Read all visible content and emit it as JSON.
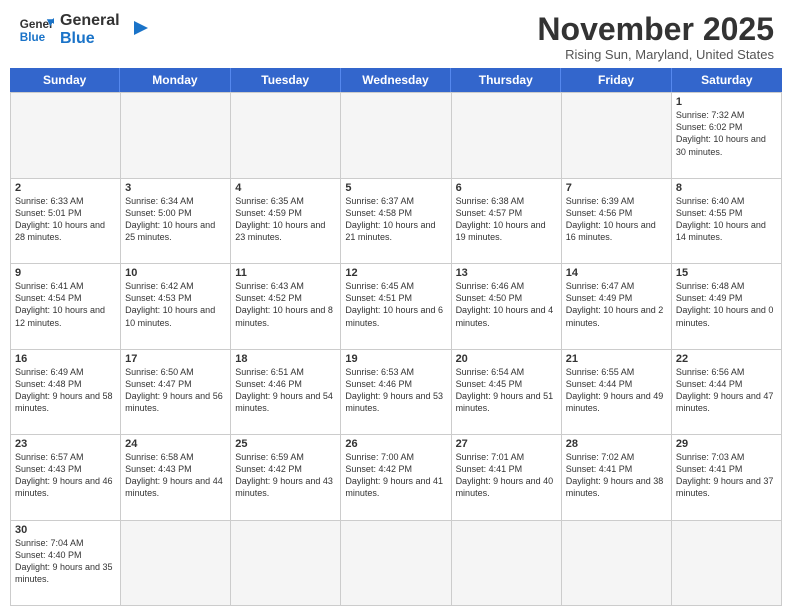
{
  "header": {
    "logo_general": "General",
    "logo_blue": "Blue",
    "month_title": "November 2025",
    "subtitle": "Rising Sun, Maryland, United States"
  },
  "days_of_week": [
    "Sunday",
    "Monday",
    "Tuesday",
    "Wednesday",
    "Thursday",
    "Friday",
    "Saturday"
  ],
  "weeks": [
    [
      {
        "day": "",
        "empty": true,
        "info": ""
      },
      {
        "day": "",
        "empty": true,
        "info": ""
      },
      {
        "day": "",
        "empty": true,
        "info": ""
      },
      {
        "day": "",
        "empty": true,
        "info": ""
      },
      {
        "day": "",
        "empty": true,
        "info": ""
      },
      {
        "day": "",
        "empty": true,
        "info": ""
      },
      {
        "day": "1",
        "empty": false,
        "info": "Sunrise: 7:32 AM\nSunset: 6:02 PM\nDaylight: 10 hours and 30 minutes."
      }
    ],
    [
      {
        "day": "2",
        "empty": false,
        "info": "Sunrise: 6:33 AM\nSunset: 5:01 PM\nDaylight: 10 hours and 28 minutes."
      },
      {
        "day": "3",
        "empty": false,
        "info": "Sunrise: 6:34 AM\nSunset: 5:00 PM\nDaylight: 10 hours and 25 minutes."
      },
      {
        "day": "4",
        "empty": false,
        "info": "Sunrise: 6:35 AM\nSunset: 4:59 PM\nDaylight: 10 hours and 23 minutes."
      },
      {
        "day": "5",
        "empty": false,
        "info": "Sunrise: 6:37 AM\nSunset: 4:58 PM\nDaylight: 10 hours and 21 minutes."
      },
      {
        "day": "6",
        "empty": false,
        "info": "Sunrise: 6:38 AM\nSunset: 4:57 PM\nDaylight: 10 hours and 19 minutes."
      },
      {
        "day": "7",
        "empty": false,
        "info": "Sunrise: 6:39 AM\nSunset: 4:56 PM\nDaylight: 10 hours and 16 minutes."
      },
      {
        "day": "8",
        "empty": false,
        "info": "Sunrise: 6:40 AM\nSunset: 4:55 PM\nDaylight: 10 hours and 14 minutes."
      }
    ],
    [
      {
        "day": "9",
        "empty": false,
        "info": "Sunrise: 6:41 AM\nSunset: 4:54 PM\nDaylight: 10 hours and 12 minutes."
      },
      {
        "day": "10",
        "empty": false,
        "info": "Sunrise: 6:42 AM\nSunset: 4:53 PM\nDaylight: 10 hours and 10 minutes."
      },
      {
        "day": "11",
        "empty": false,
        "info": "Sunrise: 6:43 AM\nSunset: 4:52 PM\nDaylight: 10 hours and 8 minutes."
      },
      {
        "day": "12",
        "empty": false,
        "info": "Sunrise: 6:45 AM\nSunset: 4:51 PM\nDaylight: 10 hours and 6 minutes."
      },
      {
        "day": "13",
        "empty": false,
        "info": "Sunrise: 6:46 AM\nSunset: 4:50 PM\nDaylight: 10 hours and 4 minutes."
      },
      {
        "day": "14",
        "empty": false,
        "info": "Sunrise: 6:47 AM\nSunset: 4:49 PM\nDaylight: 10 hours and 2 minutes."
      },
      {
        "day": "15",
        "empty": false,
        "info": "Sunrise: 6:48 AM\nSunset: 4:49 PM\nDaylight: 10 hours and 0 minutes."
      }
    ],
    [
      {
        "day": "16",
        "empty": false,
        "info": "Sunrise: 6:49 AM\nSunset: 4:48 PM\nDaylight: 9 hours and 58 minutes."
      },
      {
        "day": "17",
        "empty": false,
        "info": "Sunrise: 6:50 AM\nSunset: 4:47 PM\nDaylight: 9 hours and 56 minutes."
      },
      {
        "day": "18",
        "empty": false,
        "info": "Sunrise: 6:51 AM\nSunset: 4:46 PM\nDaylight: 9 hours and 54 minutes."
      },
      {
        "day": "19",
        "empty": false,
        "info": "Sunrise: 6:53 AM\nSunset: 4:46 PM\nDaylight: 9 hours and 53 minutes."
      },
      {
        "day": "20",
        "empty": false,
        "info": "Sunrise: 6:54 AM\nSunset: 4:45 PM\nDaylight: 9 hours and 51 minutes."
      },
      {
        "day": "21",
        "empty": false,
        "info": "Sunrise: 6:55 AM\nSunset: 4:44 PM\nDaylight: 9 hours and 49 minutes."
      },
      {
        "day": "22",
        "empty": false,
        "info": "Sunrise: 6:56 AM\nSunset: 4:44 PM\nDaylight: 9 hours and 47 minutes."
      }
    ],
    [
      {
        "day": "23",
        "empty": false,
        "info": "Sunrise: 6:57 AM\nSunset: 4:43 PM\nDaylight: 9 hours and 46 minutes."
      },
      {
        "day": "24",
        "empty": false,
        "info": "Sunrise: 6:58 AM\nSunset: 4:43 PM\nDaylight: 9 hours and 44 minutes."
      },
      {
        "day": "25",
        "empty": false,
        "info": "Sunrise: 6:59 AM\nSunset: 4:42 PM\nDaylight: 9 hours and 43 minutes."
      },
      {
        "day": "26",
        "empty": false,
        "info": "Sunrise: 7:00 AM\nSunset: 4:42 PM\nDaylight: 9 hours and 41 minutes."
      },
      {
        "day": "27",
        "empty": false,
        "info": "Sunrise: 7:01 AM\nSunset: 4:41 PM\nDaylight: 9 hours and 40 minutes."
      },
      {
        "day": "28",
        "empty": false,
        "info": "Sunrise: 7:02 AM\nSunset: 4:41 PM\nDaylight: 9 hours and 38 minutes."
      },
      {
        "day": "29",
        "empty": false,
        "info": "Sunrise: 7:03 AM\nSunset: 4:41 PM\nDaylight: 9 hours and 37 minutes."
      }
    ],
    [
      {
        "day": "30",
        "empty": false,
        "info": "Sunrise: 7:04 AM\nSunset: 4:40 PM\nDaylight: 9 hours and 35 minutes."
      },
      {
        "day": "",
        "empty": true,
        "info": ""
      },
      {
        "day": "",
        "empty": true,
        "info": ""
      },
      {
        "day": "",
        "empty": true,
        "info": ""
      },
      {
        "day": "",
        "empty": true,
        "info": ""
      },
      {
        "day": "",
        "empty": true,
        "info": ""
      },
      {
        "day": "",
        "empty": true,
        "info": ""
      }
    ]
  ]
}
